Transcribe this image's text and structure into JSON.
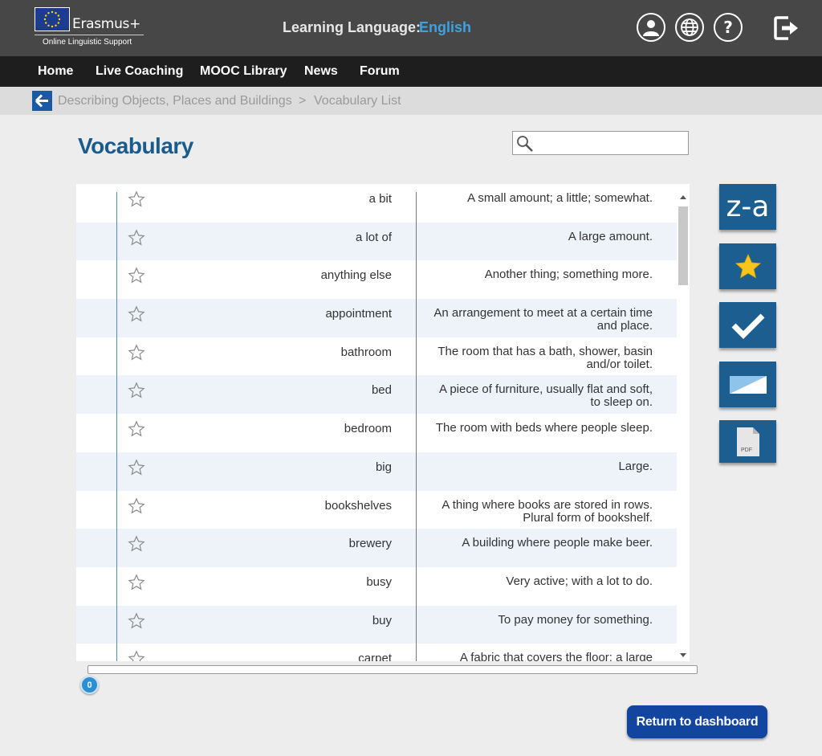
{
  "header": {
    "logo_name": "Erasmus+",
    "logo_subtitle": "Online Linguistic Support",
    "lang_label": "Learning Language:",
    "lang_value": "English",
    "icons": [
      "user-icon",
      "globe-icon",
      "help-icon",
      "logout-icon"
    ]
  },
  "nav": {
    "items": [
      "Home",
      "Live Coaching",
      "MOOC Library",
      "News",
      "Forum"
    ]
  },
  "breadcrumb": {
    "parent": "Describing Objects, Places and Buildings",
    "separator": ">",
    "current": "Vocabulary List"
  },
  "page": {
    "title": "Vocabulary",
    "search_value": ""
  },
  "vocab": [
    {
      "term": "a bit",
      "definition": "A small amount; a little; somewhat."
    },
    {
      "term": "a lot of",
      "definition": "A large amount."
    },
    {
      "term": "anything else",
      "definition": "Another thing; something more."
    },
    {
      "term": "appointment",
      "definition": "An arrangement to meet at a certain time and place."
    },
    {
      "term": "bathroom",
      "definition": "The room that has a bath, shower, basin and/or toilet."
    },
    {
      "term": "bed",
      "definition": "A piece of furniture, usually flat and soft, to sleep on."
    },
    {
      "term": "bedroom",
      "definition": "The room with beds where people sleep."
    },
    {
      "term": "big",
      "definition": "Large."
    },
    {
      "term": "bookshelves",
      "definition": "A thing where books are stored in rows. Plural form of bookshelf."
    },
    {
      "term": "brewery",
      "definition": "A building where people make beer."
    },
    {
      "term": "busy",
      "definition": "Very active; with a lot to do."
    },
    {
      "term": "buy",
      "definition": "To pay money for something."
    },
    {
      "term": "carpet",
      "definition": "A fabric that covers the floor; a large"
    }
  ],
  "tools": {
    "sort_label": "z-a",
    "pdf_label": "PDF"
  },
  "progress": {
    "value": "0"
  },
  "footer": {
    "return_label": "Return to dashboard"
  },
  "colors": {
    "accent_blue": "#1c5e90",
    "title_blue": "#1a5b8e",
    "lang_blue": "#3aa3e3",
    "button_blue": "#1245a0"
  }
}
